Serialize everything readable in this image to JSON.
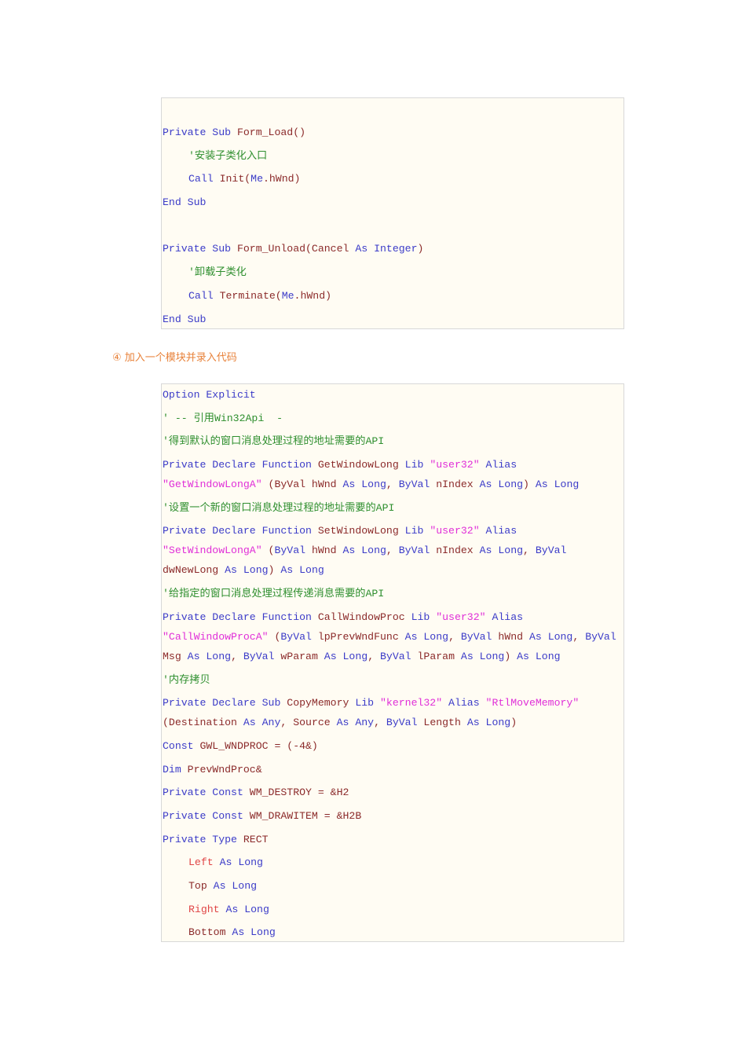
{
  "step_heading": "④ 加入一个模块并录入代码",
  "blocks": [
    {
      "lines": [
        {
          "rows": [
            [
              [
                "k",
                "Private Sub "
              ],
              [
                "i",
                "Form_Load()"
              ]
            ]
          ]
        },
        {
          "indent": true,
          "rows": [
            [
              [
                "c",
                "'安装子类化入口"
              ]
            ]
          ]
        },
        {
          "indent": true,
          "rows": [
            [
              [
                "k",
                "Call "
              ],
              [
                "i",
                "Init("
              ],
              [
                "k",
                "Me"
              ],
              [
                "i",
                ".hWnd)"
              ]
            ]
          ]
        },
        {
          "rows": [
            [
              [
                "k",
                "End Sub"
              ]
            ]
          ]
        },
        {
          "blank": true,
          "rows": []
        },
        {
          "rows": [
            [
              [
                "k",
                "Private Sub "
              ],
              [
                "i",
                "Form_Unload(Cancel "
              ],
              [
                "k",
                "As Integer"
              ],
              [
                "i",
                ")"
              ]
            ]
          ]
        },
        {
          "indent": true,
          "rows": [
            [
              [
                "c",
                "'卸载子类化"
              ]
            ]
          ]
        },
        {
          "indent": true,
          "rows": [
            [
              [
                "k",
                "Call "
              ],
              [
                "i",
                "Terminate("
              ],
              [
                "k",
                "Me"
              ],
              [
                "i",
                ".hWnd)"
              ]
            ]
          ]
        },
        {
          "rows": [
            [
              [
                "k",
                "End Sub"
              ]
            ]
          ]
        }
      ]
    },
    {
      "lines": [
        {
          "rows": [
            [
              [
                "k",
                "Option Explicit"
              ]
            ]
          ]
        },
        {
          "rows": [
            [
              [
                "c",
                "' -- 引用Win32Api  -"
              ]
            ]
          ]
        },
        {
          "rows": [
            [
              [
                "c",
                "'得到默认的窗口消息处理过程的地址需要的API"
              ]
            ]
          ]
        },
        {
          "rows": [
            [
              [
                "k",
                "Private Declare Function "
              ],
              [
                "i",
                "GetWindowLong "
              ],
              [
                "k",
                "Lib "
              ],
              [
                "s",
                "\"user32\""
              ],
              [
                "k",
                " Alias"
              ]
            ],
            [
              [
                "s",
                "\"GetWindowLongA\""
              ],
              [
                "i",
                " (ByVal hWnd "
              ],
              [
                "k",
                "As Long"
              ],
              [
                "i",
                ", "
              ],
              [
                "k",
                "ByVal "
              ],
              [
                "i",
                "nIndex "
              ],
              [
                "k",
                "As Long"
              ],
              [
                "i",
                ") "
              ],
              [
                "k",
                "As Long"
              ]
            ]
          ]
        },
        {
          "rows": [
            [
              [
                "c",
                "'设置一个新的窗口消息处理过程的地址需要的API"
              ]
            ]
          ]
        },
        {
          "rows": [
            [
              [
                "k",
                "Private Declare Function "
              ],
              [
                "i",
                "SetWindowLong "
              ],
              [
                "k",
                "Lib "
              ],
              [
                "s",
                "\"user32\""
              ],
              [
                "k",
                " Alias"
              ]
            ],
            [
              [
                "s",
                "\"SetWindowLongA\""
              ],
              [
                "i",
                " ("
              ],
              [
                "k",
                "ByVal "
              ],
              [
                "i",
                "hWnd "
              ],
              [
                "k",
                "As Long"
              ],
              [
                "i",
                ", "
              ],
              [
                "k",
                "ByVal "
              ],
              [
                "i",
                "nIndex "
              ],
              [
                "k",
                "As Long"
              ],
              [
                "i",
                ", "
              ],
              [
                "k",
                "ByVal"
              ]
            ],
            [
              [
                "i",
                "dwNewLong "
              ],
              [
                "k",
                "As Long"
              ],
              [
                "i",
                ") "
              ],
              [
                "k",
                "As Long"
              ]
            ]
          ]
        },
        {
          "rows": [
            [
              [
                "c",
                "'给指定的窗口消息处理过程传递消息需要的API"
              ]
            ]
          ]
        },
        {
          "rows": [
            [
              [
                "k",
                "Private Declare Function "
              ],
              [
                "i",
                "CallWindowProc "
              ],
              [
                "k",
                "Lib "
              ],
              [
                "s",
                "\"user32\""
              ],
              [
                "k",
                " Alias"
              ]
            ],
            [
              [
                "s",
                "\"CallWindowProcA\""
              ],
              [
                "i",
                " ("
              ],
              [
                "k",
                "ByVal "
              ],
              [
                "i",
                "lpPrevWndFunc "
              ],
              [
                "k",
                "As Long"
              ],
              [
                "i",
                ", "
              ],
              [
                "k",
                "ByVal "
              ],
              [
                "i",
                "hWnd "
              ],
              [
                "k",
                "As Long"
              ],
              [
                "i",
                ", "
              ],
              [
                "k",
                "ByVal"
              ]
            ],
            [
              [
                "i",
                "Msg "
              ],
              [
                "k",
                "As Long"
              ],
              [
                "i",
                ", "
              ],
              [
                "k",
                "ByVal "
              ],
              [
                "i",
                "wParam "
              ],
              [
                "k",
                "As Long"
              ],
              [
                "i",
                ", "
              ],
              [
                "k",
                "ByVal "
              ],
              [
                "i",
                "lParam "
              ],
              [
                "k",
                "As Long"
              ],
              [
                "i",
                ") "
              ],
              [
                "k",
                "As Long"
              ]
            ]
          ]
        },
        {
          "rows": [
            [
              [
                "c",
                "'内存拷贝"
              ]
            ]
          ]
        },
        {
          "rows": [
            [
              [
                "k",
                "Private Declare Sub "
              ],
              [
                "i",
                "CopyMemory "
              ],
              [
                "k",
                "Lib "
              ],
              [
                "s",
                "\"kernel32\""
              ],
              [
                "k",
                " Alias "
              ],
              [
                "s",
                "\"RtlMoveMemory\""
              ]
            ],
            [
              [
                "i",
                "(Destination "
              ],
              [
                "k",
                "As Any"
              ],
              [
                "i",
                ", Source "
              ],
              [
                "k",
                "As Any"
              ],
              [
                "i",
                ", "
              ],
              [
                "k",
                "ByVal "
              ],
              [
                "i",
                "Length "
              ],
              [
                "k",
                "As Long"
              ],
              [
                "i",
                ")"
              ]
            ]
          ]
        },
        {
          "rows": [
            [
              [
                "k",
                "Const "
              ],
              [
                "i",
                "GWL_WNDPROC = (-4&)"
              ]
            ]
          ]
        },
        {
          "rows": [
            [
              [
                "k",
                "Dim "
              ],
              [
                "i",
                "PrevWndProc&"
              ]
            ]
          ]
        },
        {
          "rows": [
            [
              [
                "k",
                "Private Const "
              ],
              [
                "i",
                "WM_DESTROY = &H2"
              ]
            ]
          ]
        },
        {
          "rows": [
            [
              [
                "k",
                "Private Const "
              ],
              [
                "i",
                "WM_DRAWITEM = &H2B"
              ]
            ]
          ]
        },
        {
          "rows": [
            [
              [
                "k",
                "Private Type "
              ],
              [
                "i",
                "RECT"
              ]
            ]
          ]
        },
        {
          "indent": true,
          "rows": [
            [
              [
                "r",
                "Left "
              ],
              [
                "k",
                "As Long"
              ]
            ]
          ]
        },
        {
          "indent": true,
          "rows": [
            [
              [
                "i",
                "Top "
              ],
              [
                "k",
                "As Long"
              ]
            ]
          ]
        },
        {
          "indent": true,
          "rows": [
            [
              [
                "r",
                "Right "
              ],
              [
                "k",
                "As Long"
              ]
            ]
          ]
        },
        {
          "indent": true,
          "rows": [
            [
              [
                "i",
                "Bottom "
              ],
              [
                "k",
                "As Long"
              ]
            ]
          ]
        }
      ]
    }
  ]
}
